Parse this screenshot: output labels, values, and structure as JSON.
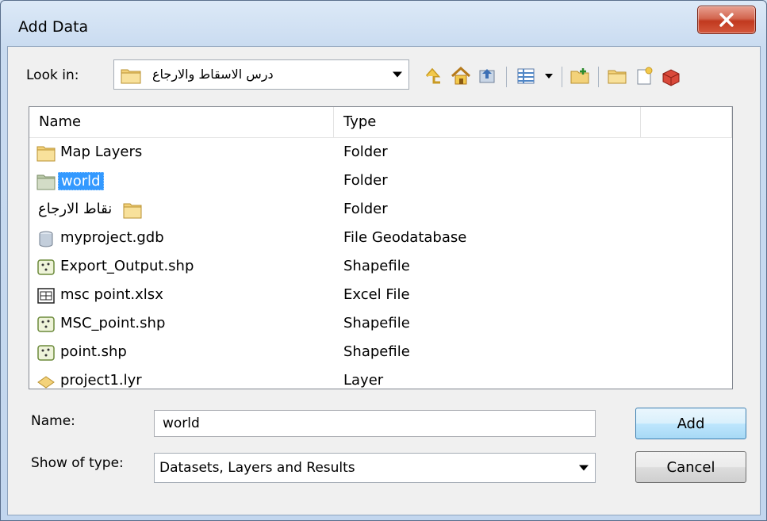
{
  "window": {
    "title": "Add Data"
  },
  "look_in": {
    "label": "Look in:",
    "value": "درس الاسقاط والارجاع"
  },
  "toolbar": {
    "icons": [
      "up-one-level-icon",
      "home-icon",
      "connect-folder-icon",
      "view-list-icon",
      "new-folder-icon",
      "catalog-folder-icon",
      "new-file-icon",
      "toolbox-icon"
    ]
  },
  "list": {
    "columns": [
      "Name",
      "Type"
    ],
    "rows": [
      {
        "name": "Map Layers",
        "type": "Folder",
        "icon": "folder-icon"
      },
      {
        "name": "world",
        "type": "Folder",
        "icon": "folder-icon",
        "selected": true
      },
      {
        "name": "نقاط الارجاع",
        "type": "Folder",
        "icon": "folder-icon"
      },
      {
        "name": "myproject.gdb",
        "type": "File Geodatabase",
        "icon": "geodatabase-icon"
      },
      {
        "name": "Export_Output.shp",
        "type": "Shapefile",
        "icon": "shapefile-icon"
      },
      {
        "name": "msc point.xlsx",
        "type": "Excel File",
        "icon": "table-icon"
      },
      {
        "name": "MSC_point.shp",
        "type": "Shapefile",
        "icon": "shapefile-icon"
      },
      {
        "name": "point.shp",
        "type": "Shapefile",
        "icon": "shapefile-icon"
      },
      {
        "name": "project1.lyr",
        "type": "Layer",
        "icon": "layer-icon"
      }
    ]
  },
  "name_field": {
    "label": "Name:",
    "value": "world"
  },
  "type_field": {
    "label": "Show of type:",
    "value": "Datasets, Layers and Results"
  },
  "buttons": {
    "add": "Add",
    "cancel": "Cancel"
  },
  "colors": {
    "selection": "#3399ff",
    "close": "#c7432a"
  }
}
